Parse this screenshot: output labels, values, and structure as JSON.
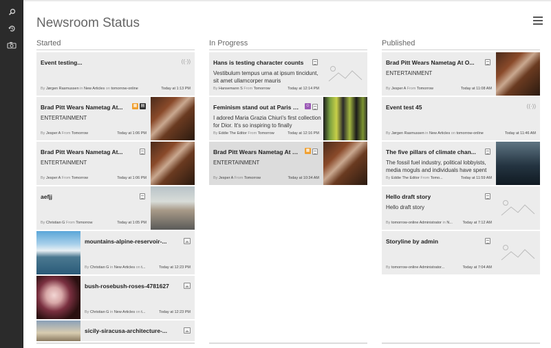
{
  "app": {
    "title": "Newsroom Status"
  },
  "sidebar": {
    "items": [
      {
        "name": "search",
        "icon": "search-icon"
      },
      {
        "name": "history",
        "icon": "history-icon"
      },
      {
        "name": "camera",
        "icon": "camera-icon"
      }
    ]
  },
  "columns": {
    "started": {
      "title": "Started",
      "cards": [
        {
          "title": "Event testing...",
          "subtitle": "",
          "by": "By",
          "author": "Jørgen Rasmussen",
          "in_label": "in",
          "section": "New Articles",
          "on_label": "on",
          "site": "tomorrow-online",
          "time": "Today at 1:13 PM",
          "type_icon": "broadcast-icon"
        },
        {
          "title": "Brad Pitt Wears Nametag At...",
          "subtitle": "ENTERTAINMENT",
          "by": "By",
          "author": "Jesper A",
          "from_label": "From",
          "site": "Tomorrow",
          "time": "Today at 1:06 PM",
          "type_icon": "document-icon"
        },
        {
          "title": "Brad Pitt Wears Nametag At...",
          "subtitle": "ENTERTAINMENT",
          "by": "By",
          "author": "Jesper A",
          "from_label": "From",
          "site": "Tomorrow",
          "time": "Today at 1:06 PM",
          "type_icon": "document-icon"
        },
        {
          "title": "aefjj",
          "subtitle": "",
          "by": "By",
          "author": "Christian G",
          "from_label": "From",
          "site": "Tomorrow",
          "time": "Today at 1:05 PM",
          "type_icon": "document-icon"
        },
        {
          "title": "mountains-alpine-reservoir-...",
          "by": "By",
          "author": "Christian G",
          "in_label": "in",
          "section": "New Articles",
          "on_label": "on",
          "site": "t...",
          "time": "Today at 12:23 PM",
          "type_icon": "image-icon"
        },
        {
          "title": "bush-rosebush-roses-4781627",
          "by": "By",
          "author": "Christian G",
          "in_label": "in",
          "section": "New Articles",
          "on_label": "on",
          "site": "t...",
          "time": "Today at 12:23 PM",
          "type_icon": "image-icon"
        },
        {
          "title": "sicily-siracusa-architecture-...",
          "type_icon": "image-icon"
        }
      ]
    },
    "in_progress": {
      "title": "In Progress",
      "cards": [
        {
          "title": "Hans is testing character counts",
          "subtitle": "Vestibulum tempus urna at ipsum tincidunt, sit amet ullamcorper mauris",
          "by": "By",
          "author": "Hansemann S",
          "from_label": "From",
          "site": "Tomorrow",
          "time": "Today at 12:14 PM",
          "type_icon": "document-icon"
        },
        {
          "title": "Feminism stand out at Paris Fa...",
          "subtitle": "I adored Maria Grazia Chiuri's first collection for Dior. It's so inspiring to finally",
          "by": "By",
          "author": "Eddie The Editor",
          "from_label": "From",
          "site": "Tomorrow",
          "time": "Today at 12:16 PM",
          "type_icon": "document-icon"
        },
        {
          "title": "Brad Pitt Wears Nametag At O...",
          "subtitle": "ENTERTAINMENT",
          "by": "By",
          "author": "Jesper A",
          "from_label": "From",
          "site": "Tomorrow",
          "time": "Today at 10:34 AM",
          "type_icon": "document-icon"
        }
      ]
    },
    "published": {
      "title": "Published",
      "cards": [
        {
          "title": "Brad Pitt Wears Nametag At O...",
          "subtitle": "ENTERTAINMENT",
          "by": "By",
          "author": "Jesper A",
          "from_label": "From",
          "site": "Tomorrow",
          "time": "Today at 11:08 AM",
          "type_icon": "document-icon"
        },
        {
          "title": "Event test 45",
          "subtitle": "",
          "by": "By",
          "author": "Jørgen Rasmussen",
          "in_label": "in",
          "section": "New Articles",
          "on_label": "on",
          "site": "tomorrow-online",
          "time": "Today at 11:46 AM",
          "type_icon": "broadcast-icon"
        },
        {
          "title": "The five pillars of climate chan...",
          "subtitle": "The fossil fuel industry, political lobbyists, media moguls and individuals have spent",
          "by": "By",
          "author": "Eddie The Editor",
          "from_label": "From",
          "site": "Tomo...",
          "time": "Today at 11:59 AM",
          "type_icon": "document-icon"
        },
        {
          "title": "Hello draft story",
          "subtitle": "Hello draft story",
          "by": "By",
          "author": "tomorrow-online Administrator",
          "in_label": "in",
          "section": "N...",
          "time": "Today at 7:12 AM",
          "type_icon": "document-icon"
        },
        {
          "title": "Storyline by admin",
          "subtitle": "",
          "by": "By",
          "author": "tomorrow-online Administrator...",
          "time": "Today at 7:04 AM",
          "type_icon": "document-icon"
        }
      ]
    }
  }
}
